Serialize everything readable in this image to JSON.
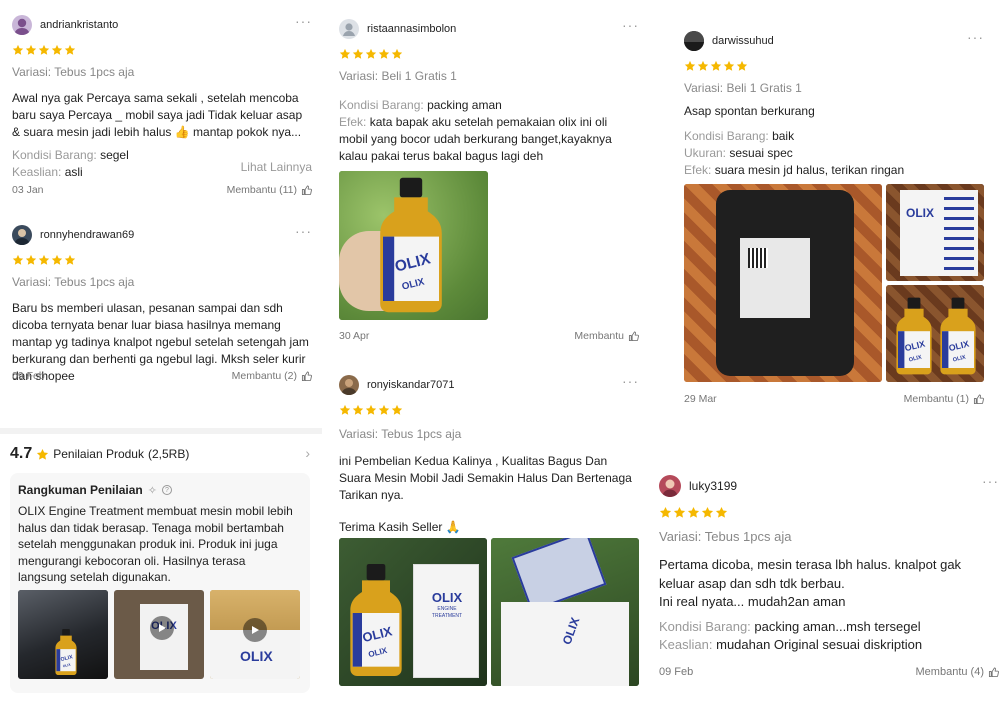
{
  "colors": {
    "star": "#f5b800",
    "muted": "#999999",
    "text": "#222222"
  },
  "col1": {
    "review1": {
      "username": "andriankristanto",
      "variation": "Variasi: Tebus 1pcs aja",
      "body": "Awal nya gak Percaya sama sekali , setelah mencoba baru saya Percaya _ mobil saya jadi Tidak keluar asap & suara mesin jadi lebih halus 👍 mantap pokok nya...",
      "attr1_key": "Kondisi Barang:",
      "attr1_val": "segel",
      "attr2_key": "Keaslian:",
      "attr2_val": "asli",
      "see_more": "Lihat Lainnya",
      "date": "03 Jan",
      "helpful": "Membantu (11)"
    },
    "review2": {
      "username": "ronnyhendrawan69",
      "variation": "Variasi: Tebus 1pcs aja",
      "body": "Baru bs memberi ulasan, pesanan sampai dan sdh dicoba ternyata benar luar biasa hasilnya memang mantap yg tadinya knalpot ngebul setelah setengah jam berkurang dan berhenti ga ngebul lagi. Mksh seler kurir dan shopee",
      "date": "09 Feb",
      "helpful": "Membantu (2)"
    },
    "rating": {
      "score": "4.7",
      "title": "Penilaian Produk",
      "count": "(2,5RB)",
      "summary_title": "Rangkuman Penilaian",
      "summary_body": "OLIX Engine Treatment membuat mesin mobil lebih halus dan tidak berasap. Tenaga mobil bertambah setelah menggunakan produk ini. Produk ini juga mengurangi kebocoran oli. Hasilnya terasa langsung setelah digunakan."
    }
  },
  "col2": {
    "review1": {
      "username": "ristaannasimbolon",
      "variation": "Variasi: Beli 1 Gratis 1",
      "attr1_key": "Kondisi Barang:",
      "attr1_val": "packing aman",
      "attr2_key": "Efek:",
      "attr2_val": "kata bapak aku setelah pemakaian olix ini oli mobil yang bocor udah berkurang banget,kayaknya kalau pakai terus bakal bagus lagi deh",
      "date": "30 Apr",
      "helpful": "Membantu"
    },
    "review2": {
      "username": "ronyiskandar7071",
      "variation": "Variasi: Tebus 1pcs aja",
      "body": "ini Pembelian Kedua Kalinya , Kualitas Bagus Dan Suara Mesin Mobil Jadi Semakin Halus Dan Bertenaga Tarikan nya.",
      "body2": "Terima Kasih Seller 🙏"
    }
  },
  "col3": {
    "review1": {
      "username": "darwissuhud",
      "variation": "Variasi: Beli 1 Gratis 1",
      "body": "Asap spontan berkurang",
      "attr1_key": "Kondisi Barang:",
      "attr1_val": "baik",
      "attr2_key": "Ukuran:",
      "attr2_val": "sesuai spec",
      "attr3_key": "Efek:",
      "attr3_val": "suara mesin jd halus, terikan ringan",
      "date": "29 Mar",
      "helpful": "Membantu (1)"
    },
    "review2": {
      "username": "luky3199",
      "variation": "Variasi: Tebus 1pcs aja",
      "body": "Pertama dicoba, mesin terasa lbh halus. knalpot gak keluar asap dan sdh tdk berbau.",
      "body2": "Ini real nyata... mudah2an aman",
      "attr1_key": "Kondisi Barang:",
      "attr1_val": "packing aman...msh tersegel",
      "attr2_key": "Keaslian:",
      "attr2_val": "mudahan Original sesuai diskription",
      "date": "09 Feb",
      "helpful": "Membantu (4)"
    }
  },
  "product_label": {
    "brand": "OLIX",
    "line1": "ENGINE",
    "line2": "TREATMENT"
  },
  "icons": [
    "more-dots-icon",
    "star-icon",
    "thumbs-up-icon",
    "chevron-right-icon",
    "sparkle-icon",
    "info-icon",
    "play-icon"
  ]
}
